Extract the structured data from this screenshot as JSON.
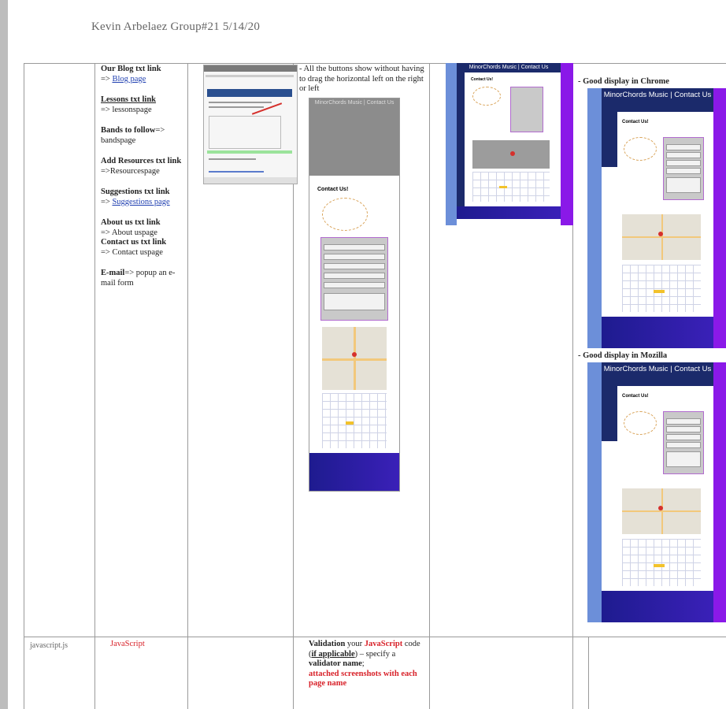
{
  "header": {
    "title": "Kevin Arbelaez Group#21 5/14/20"
  },
  "col2": {
    "blog_bold": "Our Blog txt link",
    "blog_arrow": "=> ",
    "blog_link": "Blog page",
    "lessons_bold": "Lessons txt link",
    "lessons_text": "=> lessonspage",
    "bands_bold": "Bands to follow",
    "bands_text": "=> bandspage",
    "add_bold": "Add Resources txt link",
    "add_text": "=>Resourcespage",
    "sugg_bold": "Suggestions txt link",
    "sugg_arrow": "=> ",
    "sugg_link": "Suggestions page",
    "about_bold": "About us txt link",
    "about_text": "=> About uspage",
    "contact_bold": "Contact us txt link",
    "contact_text": "=> Contact uspage",
    "email_bold": "E-mail",
    "email_text": "=> popup an e-mail form"
  },
  "col4": {
    "note": "- All the buttons show without having to drag the horizontal left on the right or left"
  },
  "col6": {
    "chrome_label": "- Good display in Chrome",
    "mozilla_label": "- Good display in Mozilla"
  },
  "shots": {
    "banner": "MinorChords Music | Contact Us",
    "contact_us": "Contact Us!"
  },
  "row2": {
    "file": "javascript.js",
    "lang": "JavaScript",
    "validation_bold": "Validation",
    "validation_mid1": " your ",
    "validation_js": "JavaScript",
    "validation_mid2": " code (",
    "validation_if": "if applicable",
    "validation_mid3": ") – specify a ",
    "validator_bold": "validator name",
    "validation_end": ";",
    "attached": "attached screenshots with each page name"
  },
  "colors": {
    "banner": "#1b2a6b",
    "footer": "#1e1b8f",
    "accent_purple": "#8a19e8",
    "side_blue": "#6c8fd9",
    "link": "#1f3fb0",
    "red": "#d8222a"
  }
}
